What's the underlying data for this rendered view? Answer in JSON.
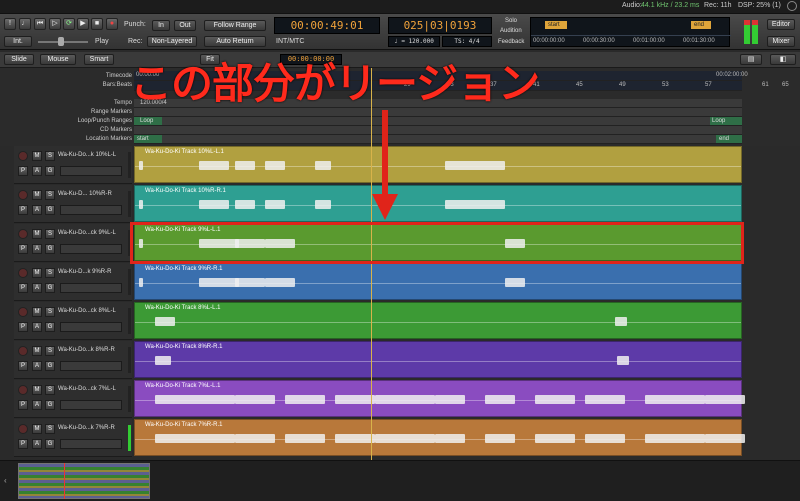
{
  "status": {
    "audio_label": "Audio:",
    "audio_value": "44.1 kHz / 23.2 ms",
    "rec": "Rec: 11h",
    "dsp": "DSP: 25% (1)"
  },
  "transport": {
    "int_label": "Int.",
    "play_label": "Play",
    "punch_label": "Punch:",
    "punch_in": "In",
    "punch_out": "Out",
    "rec_label": "Rec:",
    "rec_mode": "Non-Layered",
    "follow_range": "Follow Range",
    "auto_return": "Auto Return",
    "time_primary": "00:00:49:01",
    "time_secondary": "INT/MTC",
    "bbt": "025|03|0193",
    "tempo": "♩ = 120.000",
    "ts": "TS: 4/4",
    "solo": "Solo",
    "audition": "Audition",
    "feedback": "Feedback",
    "mini_start": "start",
    "mini_end": "end",
    "mini_times": [
      "00:00:00:00",
      "00:00:30:00",
      "00:01:00:00",
      "00:01:30:00"
    ],
    "editor_btn": "Editor",
    "mixer_btn": "Mixer"
  },
  "toolbar2": {
    "slide": "Slide",
    "mouse": "Mouse",
    "smart": "Smart",
    "fit_label": "Fit",
    "time_display": "00:00:00:00"
  },
  "rulers": {
    "timecode_label": "Timecode",
    "bars_label": "Bars:Beats",
    "tempo_label": "Tempo",
    "range_label": "Range Markers",
    "loop_label": "Loop/Punch Ranges",
    "cd_label": "CD Markers",
    "location_label": "Location Markers",
    "timecode_start": "00:00:00",
    "timecode_end": "00:02:00:00",
    "bar_numbers": [
      "29",
      "33",
      "37",
      "41",
      "45",
      "49",
      "53",
      "57",
      "61",
      "65"
    ],
    "tempo_value": "120.000/4",
    "loop_start": "Loop",
    "loop_end": "Loop",
    "loc_start": "start",
    "loc_end": "end"
  },
  "annotation": {
    "text": "この部分がリージョン"
  },
  "tracks": [
    {
      "name": "Wa-Ku-Do...k 10%L-L",
      "region": "Wa-Ku-Do-Ki Track 10%L-L.1",
      "color": "#b1a040"
    },
    {
      "name": "Wa-Ku-D... 10%R-R",
      "region": "Wa-Ku-Do-Ki Track 10%R-R.1",
      "color": "#2e9f92"
    },
    {
      "name": "Wa-Ku-Do...ck 9%L-L",
      "region": "Wa-Ku-Do-Ki Track 9%L-L.1",
      "color": "#5a9a2f"
    },
    {
      "name": "Wa-Ku-D...k 9%R-R",
      "region": "Wa-Ku-Do-Ki Track 9%R-R.1",
      "color": "#3a6fae"
    },
    {
      "name": "Wa-Ku-Do...ck 8%L-L",
      "region": "Wa-Ku-Do-Ki Track 8%L-L.1",
      "color": "#3c9a35"
    },
    {
      "name": "Wa-Ku-Do...k 8%R-R",
      "region": "Wa-Ku-Do-Ki Track 8%R-R.1",
      "color": "#5d3aa8"
    },
    {
      "name": "Wa-Ku-Do...ck 7%L-L",
      "region": "Wa-Ku-Do-Ki Track 7%L-L.1",
      "color": "#8a4cc0"
    },
    {
      "name": "Wa-Ku-Do...k 7%R-R",
      "region": "Wa-Ku-Do-Ki Track 7%R-R.1",
      "color": "#b8783a"
    }
  ],
  "track_buttons": {
    "m": "M",
    "s": "S",
    "p": "P",
    "a": "A",
    "g": "G"
  }
}
